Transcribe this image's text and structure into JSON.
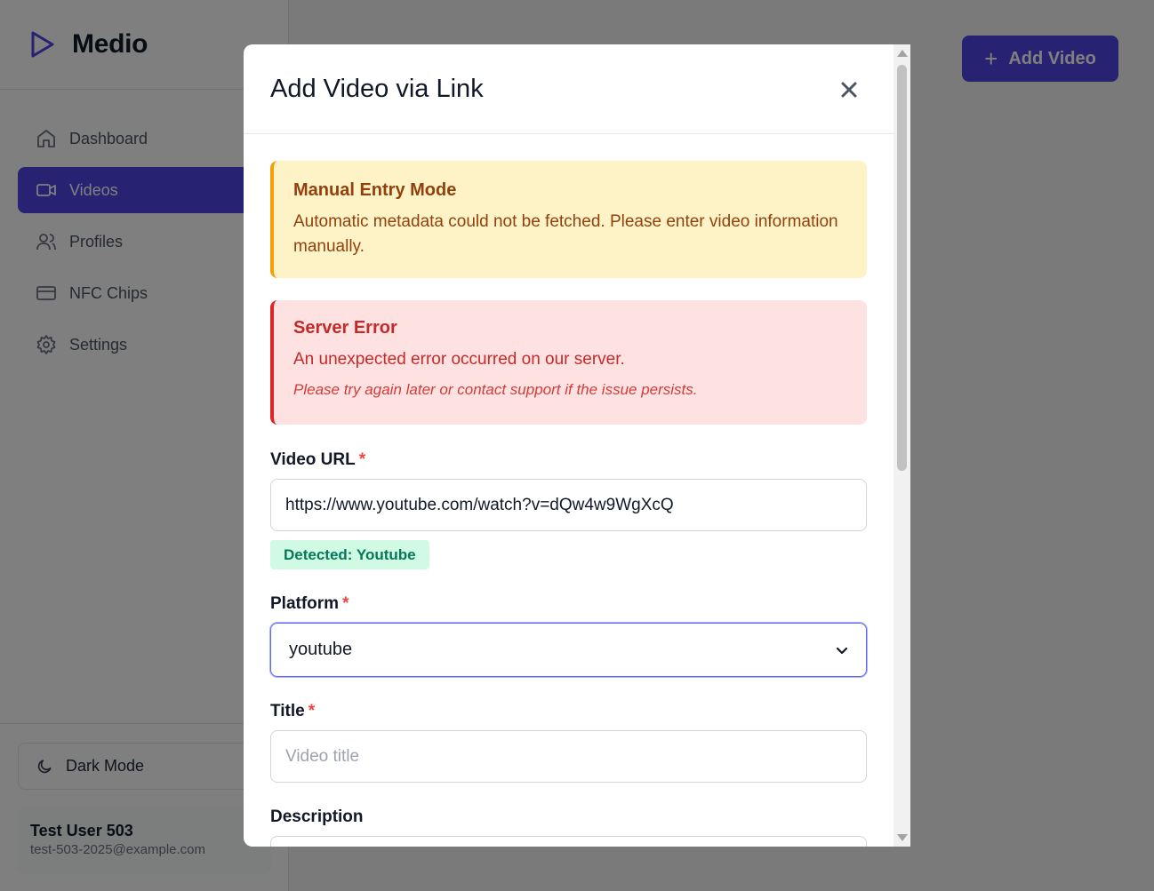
{
  "app": {
    "brand_name": "Medio",
    "nav": [
      {
        "label": "Dashboard",
        "icon": "home-icon"
      },
      {
        "label": "Videos",
        "icon": "video-icon",
        "active": true
      },
      {
        "label": "Profiles",
        "icon": "users-icon"
      },
      {
        "label": "NFC Chips",
        "icon": "card-icon"
      },
      {
        "label": "Settings",
        "icon": "gear-icon"
      }
    ],
    "dark_mode_label": "Dark Mode",
    "user": {
      "name": "Test User 503",
      "email": "test-503-2025@example.com"
    },
    "add_video_label": "Add Video",
    "accent_color": "#4f46e5"
  },
  "modal": {
    "title": "Add Video via Link",
    "warning": {
      "title": "Manual Entry Mode",
      "text": "Automatic metadata could not be fetched. Please enter video information manually."
    },
    "error": {
      "title": "Server Error",
      "text": "An unexpected error occurred on our server.",
      "hint": "Please try again later or contact support if the issue persists."
    },
    "fields": {
      "url_label": "Video URL",
      "url_value": "https://www.youtube.com/watch?v=dQw4w9WgXcQ",
      "detected_badge": "Detected: Youtube",
      "platform_label": "Platform",
      "platform_value": "youtube",
      "title_label": "Title",
      "title_placeholder": "Video title",
      "description_label": "Description",
      "required_marker": "*"
    }
  }
}
